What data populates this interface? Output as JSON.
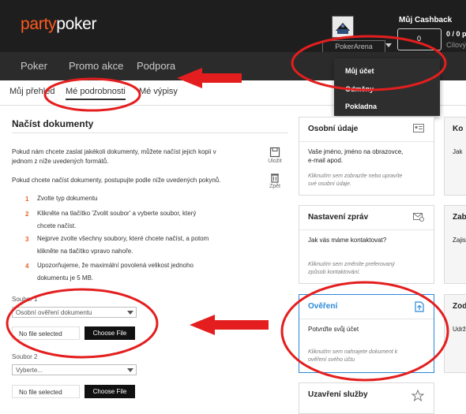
{
  "header": {
    "logo_party": "party",
    "logo_poker": "poker",
    "username": "PokerArena",
    "cashback_title": "Můj Cashback",
    "cashback_box": "0",
    "cashback_value": "0 / 0 p",
    "cashback_sub": "Cílový"
  },
  "nav": {
    "items": [
      "Poker",
      "Promo akce",
      "Podpora"
    ]
  },
  "account_menu": {
    "items": [
      "Můj účet",
      "Odměny",
      "Pokladna"
    ]
  },
  "subnav": {
    "tabs": [
      "Můj přehled",
      "Mé podrobnosti",
      "Mé výpisy"
    ]
  },
  "documents": {
    "title": "Načíst dokumenty",
    "para1_line1": "Pokud nám chcete zaslat jakékoli dokumenty, můžete načíst jejich kopii v",
    "para1_line2": "jednom z níže uvedených formátů.",
    "para2": "Pokud chcete načíst dokumenty, postupujte podle níže uvedených pokynů.",
    "save_label": "Uložit",
    "print_label": "Zpět",
    "steps": [
      {
        "num": "1",
        "line1": "Zvolte typ dokumentu",
        "line2": ""
      },
      {
        "num": "2",
        "line1": "Klikněte na tlačítko 'Zvolit soubor' a vyberte soubor, který",
        "line2": "chcete načíst."
      },
      {
        "num": "3",
        "line1": "Nejprve zvolte všechny soubory, které chcete načíst, a potom",
        "line2": "klikněte na tlačítko vpravo nahoře."
      },
      {
        "num": "4",
        "line1": "Upozorňujeme, že maximální povolená velikost jednoho",
        "line2": "dokumentu je 5 MB."
      }
    ],
    "file1_label": "Soubor 1",
    "file1_select": "Osobní ověření dokumentu",
    "file1_status": "No file selected",
    "file_button": "Choose File",
    "file2_label": "Soubor 2",
    "file2_select": "Vyberte...",
    "file2_status": "No file selected"
  },
  "cards": {
    "personal": {
      "title": "Osobní údaje",
      "body_line1": "Vaše jméno, jméno na obrazovce,",
      "body_line2": "e-mail apod.",
      "note_line1": "Kliknutím sem zobrazíte nebo upravíte",
      "note_line2": "své osobní údaje."
    },
    "messages": {
      "title": "Nastavení zpráv",
      "body_line1": "Jak vás máme kontaktovat?",
      "note_line1": "Kliknutím sem změníte preferovaný",
      "note_line2": "způsob kontaktování."
    },
    "verification": {
      "title": "Ověření",
      "body_line1": "Potvrďte svůj účet",
      "note_line1": "Kliknutím sem nahrajete dokument k",
      "note_line2": "ověření svého účtu"
    },
    "closure": {
      "title": "Uzavření služby"
    },
    "right1": {
      "title": "Ko",
      "body_line1": "Jak"
    },
    "right2": {
      "title": "Zab",
      "body_line1": "Zajis"
    },
    "right3": {
      "title": "Zod",
      "body_line1": "Udrž"
    }
  },
  "colors": {
    "brand_orange": "#ff5a1f",
    "header_bg": "#1e1e1e",
    "step_number": "#e8622c",
    "active_card": "#2a88d8",
    "annotation_red": "#e41e1e"
  }
}
